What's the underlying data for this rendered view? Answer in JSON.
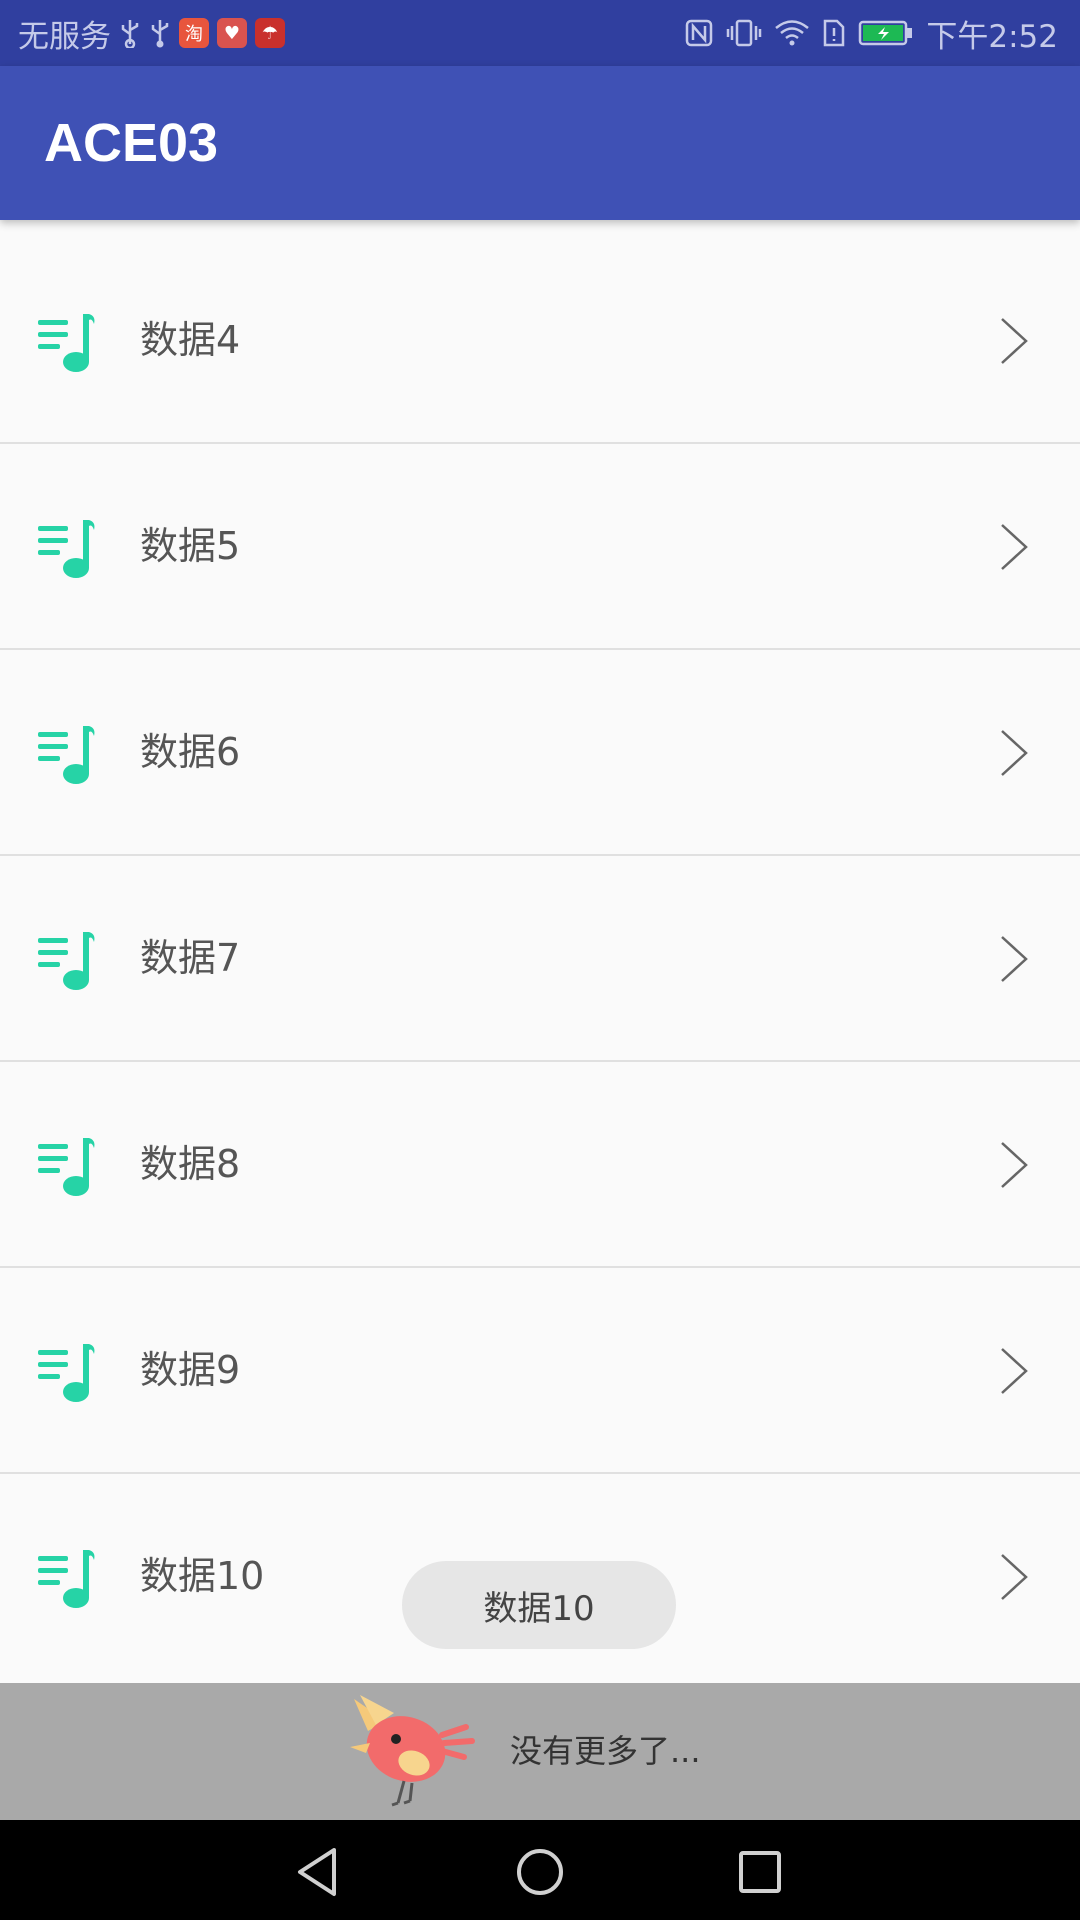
{
  "status_bar": {
    "carrier": "无服务",
    "time": "下午2:52",
    "icons_left": [
      "usb-icon",
      "usb-icon",
      "taobao-app-icon",
      "heart-app-icon",
      "cloud-app-icon"
    ],
    "icons_right": [
      "nfc-icon",
      "vibrate-icon",
      "wifi-icon",
      "sim-icon",
      "battery-charging-icon"
    ],
    "colors": {
      "background": "#303f9f",
      "text": "#c5cae9"
    }
  },
  "app_bar": {
    "title": "ACE03",
    "color": "#3f51b5"
  },
  "list": {
    "icon": "music-list-icon",
    "icon_color": "#26d3a6",
    "chevron": "chevron-right-icon",
    "items": [
      {
        "label": "数据4"
      },
      {
        "label": "数据5"
      },
      {
        "label": "数据6"
      },
      {
        "label": "数据7"
      },
      {
        "label": "数据8"
      },
      {
        "label": "数据9"
      },
      {
        "label": "数据10"
      }
    ]
  },
  "toast": {
    "text": "数据10"
  },
  "footer": {
    "text": "没有更多了...",
    "mascot": "bird-illustration"
  },
  "nav_bar": {
    "buttons": [
      "back-icon",
      "home-icon",
      "recents-icon"
    ]
  }
}
